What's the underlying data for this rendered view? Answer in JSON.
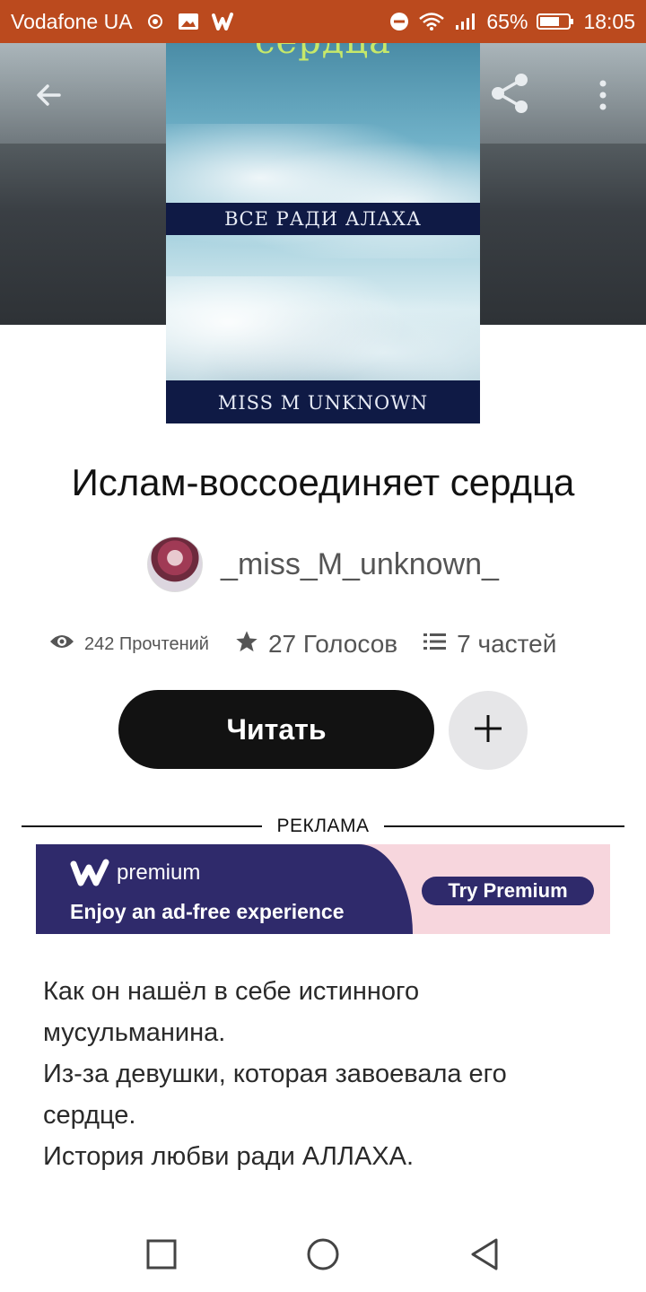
{
  "status_bar": {
    "carrier": "Vodafone UA",
    "battery": "65%",
    "time": "18:05",
    "background": "#bb4a1e"
  },
  "toolbar": {
    "back_icon": "arrow-left-icon",
    "share_icon": "share-icon",
    "more_icon": "more-vertical-icon"
  },
  "cover": {
    "title_top": "сердца",
    "subtitle": "ВСЕ РАДИ АЛАХА",
    "author_band": "MISS M UNKNOWN"
  },
  "book": {
    "title": "Ислам-воссоединяет сердца",
    "author": "_miss_M_unknown_"
  },
  "stats": {
    "reads": "242 Прочтений",
    "votes": "27 Голосов",
    "parts": "7 частей"
  },
  "actions": {
    "read_label": "Читать",
    "add_icon": "plus-icon"
  },
  "ad": {
    "label": "РЕКЛАМА",
    "brand": "premium",
    "tagline": "Enjoy an ad-free experience",
    "cta": "Try Premium"
  },
  "description": {
    "lines": [
      "Как он нашёл в себе истинного",
      "мусульманина.",
      "Из-за девушки, которая завоевала его",
      "сердце.",
      "История любви ради АЛЛАХА."
    ]
  },
  "colors": {
    "accent": "#bb4a1e",
    "button_dark": "#121212",
    "ad_purple": "#2f2a6b",
    "ad_pink": "#f7d6dd"
  }
}
